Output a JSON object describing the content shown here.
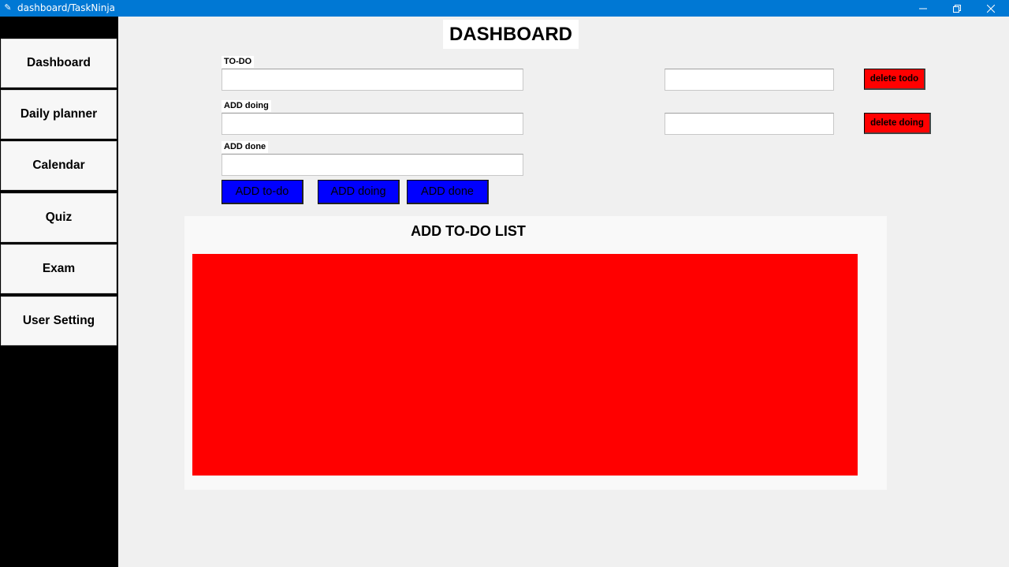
{
  "window": {
    "title": "dashboard/TaskNinja",
    "app_icon": "feather-icon",
    "controls": [
      "minimize-icon",
      "restore-icon",
      "close-icon"
    ]
  },
  "sidebar": {
    "items": [
      {
        "label": "Dashboard"
      },
      {
        "label": "Daily planner"
      },
      {
        "label": "Calendar"
      },
      {
        "label": "Quiz"
      },
      {
        "label": "Exam"
      },
      {
        "label": "User Setting"
      }
    ]
  },
  "main": {
    "title": "DASHBOARD",
    "todo_label": "TO-DO",
    "doing_label": "ADD doing",
    "done_label": "ADD done",
    "todo_value": "",
    "doing_value": "",
    "done_value": "",
    "delete_todo_value": "",
    "delete_doing_value": "",
    "delete_todo_button": "delete todo",
    "delete_doing_button": "delete doing",
    "add_todo_button": "ADD to-do",
    "add_doing_button": "ADD doing",
    "add_done_button": "ADD done",
    "list_title": "ADD TO-DO LIST"
  },
  "colors": {
    "titlebar": "#0078d4",
    "sidebar": "#000000",
    "delete_buttons": "#ff0000",
    "add_buttons": "#0000ff",
    "list_area": "#ff0000"
  }
}
